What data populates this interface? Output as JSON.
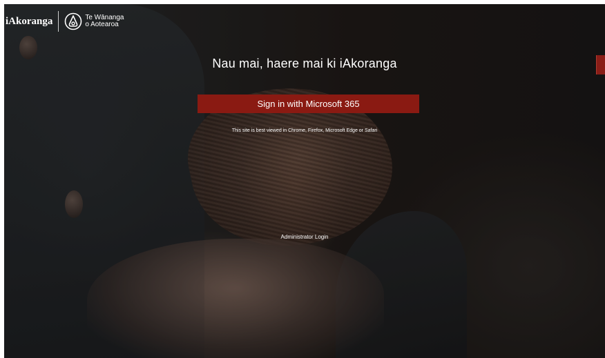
{
  "header": {
    "brand_name": "iAkoranga",
    "partner_logo": {
      "line1": "Te Wānanga",
      "line2": "o Aotearoa",
      "icon": "wananga-logo-icon"
    }
  },
  "main": {
    "welcome_title": "Nau mai, haere mai ki iAkoranga",
    "signin_button_label": "Sign in with Microsoft 365",
    "browser_note": "This site is best viewed in Chrome, Firefox, Microsoft Edge or Safari",
    "admin_link_label": "Administrator Login"
  },
  "colors": {
    "accent": "#8a1a12",
    "text": "#ffffff"
  }
}
